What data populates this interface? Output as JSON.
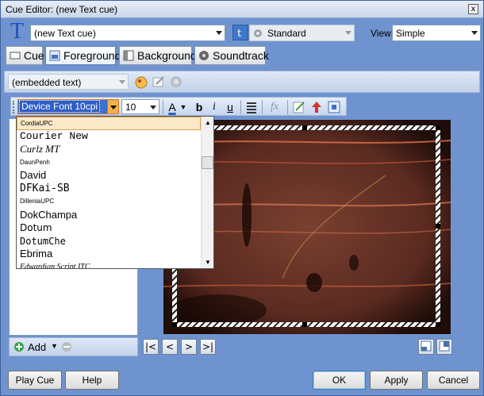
{
  "window": {
    "title": "Cue Editor: (new Text cue)",
    "close_glyph": "x"
  },
  "cue": {
    "name": "(new Text cue)",
    "style": "Standard",
    "view_label": "View:",
    "view": "Simple"
  },
  "tabs": [
    {
      "label": "Cue",
      "icon": "cue-icon"
    },
    {
      "label": "Foreground",
      "icon": "foreground-icon"
    },
    {
      "label": "Background",
      "icon": "background-icon"
    },
    {
      "label": "Soundtrack",
      "icon": "soundtrack-icon"
    }
  ],
  "source": {
    "value": "(embedded text)"
  },
  "format": {
    "font": "Device Font 10cpi",
    "size": "10",
    "font_color_letter": "A",
    "bold": "b",
    "italic": "i",
    "underline": "u",
    "fx": "fx"
  },
  "font_list": [
    "CordiaUPC",
    "Courier New",
    "Curlz MT",
    "DaunPenh",
    "David",
    "DFKai-SB",
    "DilleniaUPC",
    "DokChampa",
    "Dotum",
    "DotumChe",
    "Ebrima",
    "Edwardian Script ITC"
  ],
  "bottom_left": {
    "add_label": "Add"
  },
  "buttons": {
    "play": "Play Cue",
    "help": "Help",
    "ok": "OK",
    "apply": "Apply",
    "cancel": "Cancel"
  },
  "colors": {
    "window_bg": "#6f93cf",
    "accent": "#1f4fbf",
    "selected_font_bg": "#fbe8c8"
  }
}
